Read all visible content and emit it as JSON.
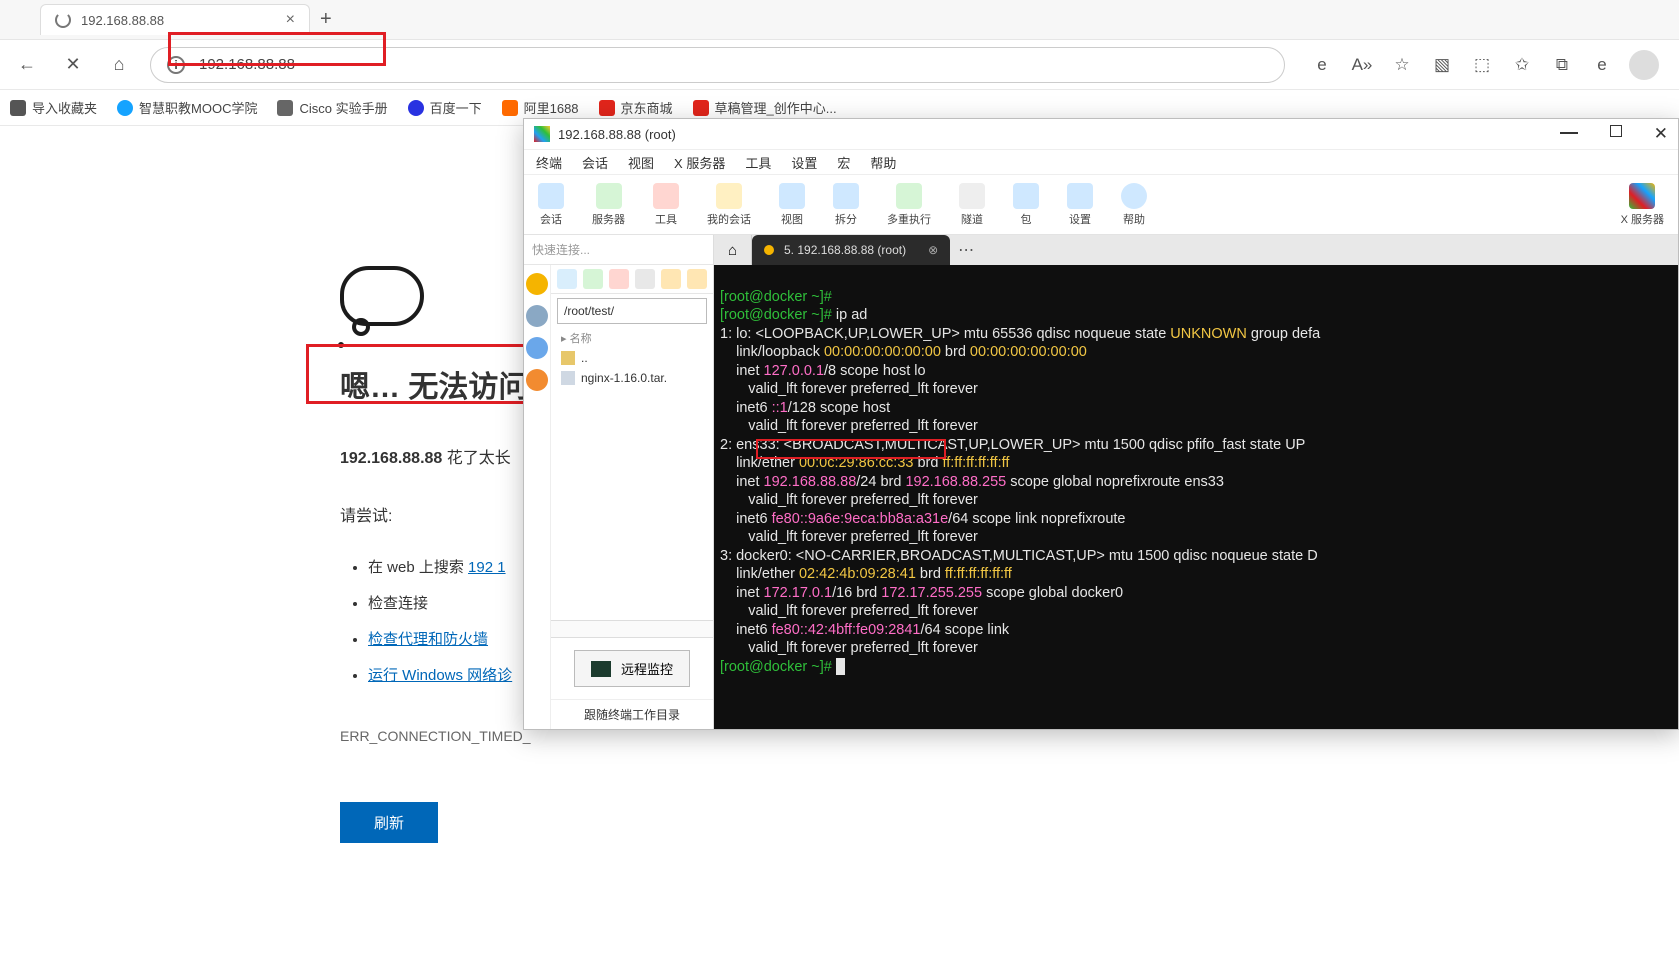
{
  "browser": {
    "tab": {
      "title": "192.168.88.88"
    },
    "url": "192.168.88.88",
    "bookmarks": [
      {
        "label": "导入收藏夹",
        "color": "#555"
      },
      {
        "label": "智慧职教MOOC学院",
        "color": "#15a3ff"
      },
      {
        "label": "Cisco 实验手册",
        "color": "#666"
      },
      {
        "label": "百度一下",
        "color": "#e10900"
      },
      {
        "label": "阿里1688",
        "color": "#ff6a00"
      },
      {
        "label": "京东商城",
        "color": "#e1251b"
      },
      {
        "label": "草稿管理_创作中心...",
        "color": "#e1251b"
      }
    ]
  },
  "error_page": {
    "title": "嗯… 无法访问",
    "sub_prefix": "192.168.88.88",
    "sub_suffix": " 花了太长",
    "try_label": "请尝试:",
    "items": {
      "search_prefix": "在 web 上搜索 ",
      "search_link": "192 1",
      "check_conn": "检查连接",
      "proxy_link": "检查代理和防火墙",
      "windiag_link": "运行 Windows 网络诊",
      "err_code": "ERR_CONNECTION_TIMED_"
    },
    "refresh": "刷新"
  },
  "termwin": {
    "title": "192.168.88.88 (root)",
    "menus": [
      "终端",
      "会话",
      "视图",
      "X 服务器",
      "工具",
      "设置",
      "宏",
      "帮助"
    ],
    "tools": [
      {
        "label": "会话",
        "c": "#1d90ff"
      },
      {
        "label": "服务器",
        "c": "#2fbf3a"
      },
      {
        "label": "工具",
        "c": "#e0443a"
      },
      {
        "label": "我的会话",
        "c": "#f5b400"
      },
      {
        "label": "视图",
        "c": "#15a3ff"
      },
      {
        "label": "拆分",
        "c": "#15a3ff"
      },
      {
        "label": "多重执行",
        "c": "#2fbf3a"
      },
      {
        "label": "隧道",
        "c": "#444"
      },
      {
        "label": "包",
        "c": "#1d90ff"
      },
      {
        "label": "设置",
        "c": "#15a3ff"
      },
      {
        "label": "帮助",
        "c": "#15a3ff"
      }
    ],
    "xserver_label": "X 服务器",
    "quick_placeholder": "快速连接...",
    "path": "/root/test/",
    "fs_header": "名称",
    "fs_items": [
      "..",
      "nginx-1.16.0.tar."
    ],
    "remote_btn": "远程监控",
    "follow": "跟随终端工作目录",
    "sshtab": "5. 192.168.88.88 (root)"
  },
  "terminal_text": {
    "l01_prompt": "[root@docker ~]# ",
    "l02_prompt": "[root@docker ~]# ",
    "l02_cmd": "ip ad",
    "l03": "1: lo: <LOOPBACK,UP,LOWER_UP> mtu 65536 qdisc noqueue state ",
    "l03_state": "UNKNOWN",
    "l03_tail": " group defa",
    "l04a": "    link/loopback ",
    "l04b": "00:00:00:00:00:00",
    "l04c": " brd ",
    "l04d": "00:00:00:00:00:00",
    "l05a": "    inet ",
    "l05b": "127.0.0.1",
    "l05c": "/8 scope host lo",
    "l06": "       valid_lft forever preferred_lft forever",
    "l07a": "    inet6 ",
    "l07b": "::1",
    "l07c": "/128 scope host",
    "l08": "       valid_lft forever preferred_lft forever",
    "l09": "2: ens33: <BROADCAST,MULTICAST,UP,LOWER_UP> mtu 1500 qdisc pfifo_fast state UP",
    "l10a": "    link/ether ",
    "l10b": "00:0c:29:86:cc:33",
    "l10c": " brd ",
    "l10d": "ff:ff:ff:ff:ff:ff",
    "l11a": "    inet ",
    "l11b": "192.168.88.88",
    "l11c": "/24",
    "l11d": " brd ",
    "l11e": "192.168.88.255",
    "l11f": " scope global noprefixroute ens33",
    "l12": "       valid_lft forever preferred_lft forever",
    "l13a": "    inet6 ",
    "l13b": "fe80::9a6e:9eca:bb8a:a31e",
    "l13c": "/64 scope link noprefixroute",
    "l14": "       valid_lft forever preferred_lft forever",
    "l15": "3: docker0: <NO-CARRIER,BROADCAST,MULTICAST,UP> mtu 1500 qdisc noqueue state D",
    "l16a": "    link/ether ",
    "l16b": "02:42:4b:09:28:41",
    "l16c": " brd ",
    "l16d": "ff:ff:ff:ff:ff:ff",
    "l17a": "    inet ",
    "l17b": "172.17.0.1",
    "l17c": "/16 brd ",
    "l17d": "172.17.255.255",
    "l17e": " scope global docker0",
    "l18": "       valid_lft forever preferred_lft forever",
    "l19a": "    inet6 ",
    "l19b": "fe80::42:4bff:fe09:2841",
    "l19c": "/64 scope link",
    "l20": "       valid_lft forever preferred_lft forever",
    "l21_prompt": "[root@docker ~]# "
  }
}
